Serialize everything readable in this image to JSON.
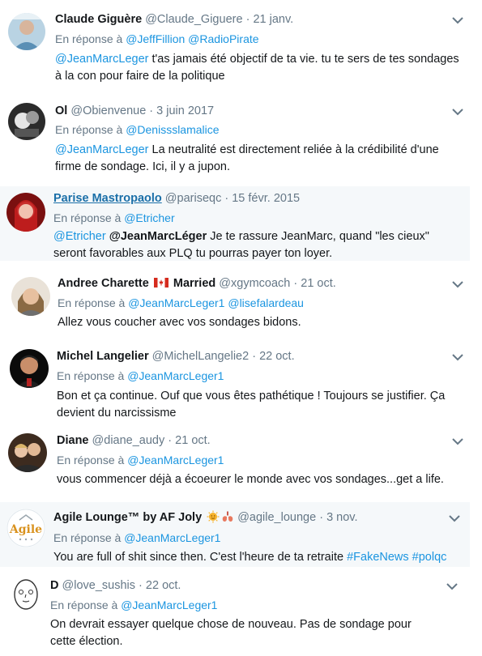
{
  "tweets": [
    {
      "name": "Claude Giguère",
      "handle": "@Claude_Giguere",
      "date": "21 janv.",
      "reply_prefix": "En réponse à",
      "reply_to": [
        "@JeffFillion",
        "@RadioPirate"
      ],
      "mention": "@JeanMarcLeger",
      "text": " t'as jamais été objectif de ta vie. tu te sers de tes sondages à la con pour faire de la politique"
    },
    {
      "name": "Ol",
      "handle": "@Obienvenue",
      "date": "3 juin 2017",
      "reply_prefix": "En réponse à",
      "reply_to": [
        "@Denissslamalice"
      ],
      "mention": "@JeanMarcLeger",
      "text": " La neutralité est directement reliée à la crédibilité d'une firme de sondage. Ici, il y a jupon."
    },
    {
      "name": "Parise Mastropaolo",
      "handle": "@pariseqc",
      "date": "15 févr. 2015",
      "reply_prefix": "En réponse à",
      "reply_to": [
        "@Etricher"
      ],
      "mention": "@Etricher",
      "bold_mention": "@JeanMarcLéger",
      "text": " Je te rassure JeanMarc, quand \"les cieux\" seront favorables aux PLQ tu pourras payer ton loyer."
    },
    {
      "name_part1": "Andree Charette",
      "name_part2": "Married",
      "flag_icon": "canada-flag-icon",
      "handle": "@xgymcoach",
      "date": "21 oct.",
      "reply_prefix": "En réponse à",
      "reply_to": [
        "@JeanMarcLeger1",
        "@lisefalardeau"
      ],
      "text": "Allez vous coucher avec vos sondages bidons."
    },
    {
      "name": "Michel Langelier",
      "handle": "@MichelLangelie2",
      "date": "22 oct.",
      "reply_prefix": "En réponse à",
      "reply_to": [
        "@JeanMarcLeger1"
      ],
      "text": "Bon et ça continue. Ouf que vous êtes pathétique ! Toujours se justifier. Ça devient du narcissisme"
    },
    {
      "name": "Diane",
      "handle": "@diane_audy",
      "date": "21 oct.",
      "reply_prefix": "En réponse à",
      "reply_to": [
        "@JeanMarcLeger1"
      ],
      "text": "vous commencer déjà a écoeurer le monde avec vos sondages...get a life."
    },
    {
      "name": "Agile Lounge™ by AF Joly",
      "emoji_icons": [
        "sun-face-icon",
        "lungs-icon"
      ],
      "handle": "@agile_lounge",
      "date": "3 nov.",
      "reply_prefix": "En réponse à",
      "reply_to": [
        "@JeanMarcLeger1"
      ],
      "text": "You are full of shit since then.  C'est l'heure de ta retraite ",
      "hashtags": [
        "#FakeNews",
        "#polqc"
      ],
      "avatar_logo_text": "Agile"
    },
    {
      "name": "D",
      "handle": "@love_sushis",
      "date": "22 oct.",
      "reply_prefix": "En réponse à",
      "reply_to": [
        "@JeanMarcLeger1"
      ],
      "text": "On devrait essayer quelque chose de nouveau. Pas de sondage pour cette élection."
    }
  ],
  "colors": {
    "link": "#1b95e0",
    "secondary": "#657786",
    "highlight_bg": "#f5f8fa"
  }
}
